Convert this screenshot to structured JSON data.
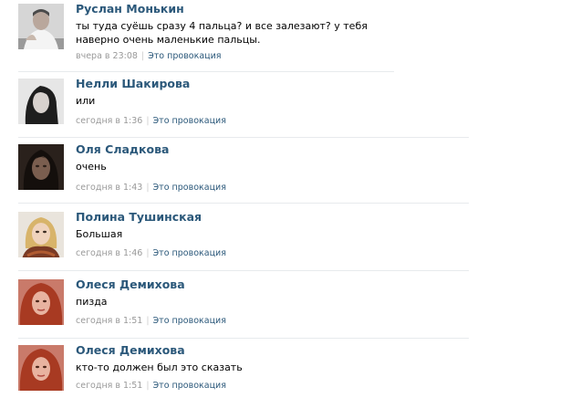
{
  "comments": [
    {
      "author": "Руслан Монькин",
      "text": "ты туда суёшь сразу 4 пальца? и все залезают? у тебя наверно очень маленькие пальцы.",
      "time": "вчера в 23:08",
      "action": "Это провокация",
      "avatar": "man-white-shirt"
    },
    {
      "author": "Нелли Шакирова",
      "text": "или",
      "time": "сегодня в 1:36",
      "action": "Это провокация",
      "avatar": "woman-dark-hair-bw"
    },
    {
      "author": "Оля Сладкова",
      "text": "очень",
      "time": "сегодня в 1:43",
      "action": "Это провокация",
      "avatar": "woman-dark-photo"
    },
    {
      "author": "Полина Тушинская",
      "text": "Большая",
      "time": "сегодня в 1:46",
      "action": "Это провокация",
      "avatar": "woman-blonde-scarf"
    },
    {
      "author": "Олеся Демихова",
      "text": "пизда",
      "time": "сегодня в 1:51",
      "action": "Это провокация",
      "avatar": "woman-red-hair"
    },
    {
      "author": "Олеся Демихова",
      "text": "кто-то должен был это сказать",
      "time": "сегодня в 1:51",
      "action": "Это провокация",
      "avatar": "woman-red-hair"
    }
  ],
  "colors": {
    "author_link": "#2b587a",
    "meta_text": "#999999",
    "divider": "#e7eaed"
  }
}
